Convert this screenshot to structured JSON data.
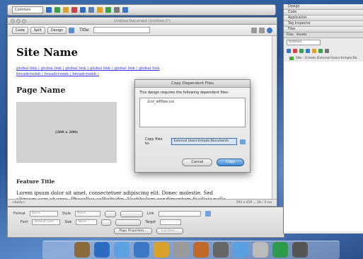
{
  "insert_bar": {
    "category": "Common",
    "icon_colors": [
      "#2d6cc0",
      "#3aa04a",
      "#d9a12a",
      "#c44",
      "#2d6cc0",
      "#5a7fb0",
      "#e0a020",
      "#3aa04a",
      "#7a7a7a",
      "#3a78c4"
    ]
  },
  "document": {
    "window_title": "Untitled Document (Untitled-2*)",
    "view_buttons": [
      "Code",
      "Split",
      "Design"
    ],
    "title_label": "Title:",
    "site_name": "Site Name",
    "nav_links_line1": "global link | global link | global link | global link | global link | global link",
    "nav_links_line2": "breadcrumb | breadcrumb | breadcrumb |",
    "page_name": "Page Name",
    "image_placeholder": "(200 x 200)",
    "feature_title": "Feature Title",
    "lorem": "Lorem ipsum dolor sit amet, consectetuer adipiscing elit. Donec molestie. Sed aliquam sem ut arcu. Phasellus sollicitudin. Vestibulum condimentum facilisis nulla. In hac",
    "status_tag": "<body>",
    "status_size": "593 x 459 ⌄ 28 / 3 sec"
  },
  "dialog": {
    "title": "Copy Dependent Files",
    "message": "This design requires the following dependent files:",
    "file": "2col_leftNav.css",
    "copy_label": "Copy files to:",
    "copy_path": "External Users:trimple:Documents",
    "cancel": "Cancel",
    "copy": "Copy"
  },
  "properties": {
    "format_label": "Format",
    "format_value": "None",
    "style_label": "Style",
    "style_value": "None",
    "link_label": "Link",
    "font_label": "Font",
    "font_value": "Default Font",
    "size_label": "Size",
    "size_value": "None",
    "target_label": "Target",
    "page_props": "Page Properties...",
    "list_item": "List Item..."
  },
  "panels": {
    "headers": [
      "Design",
      "Code",
      "Application",
      "Tag Inspector",
      "Files"
    ],
    "files_tabs": [
      "Files",
      "Assets"
    ],
    "site_combo": "Untitled",
    "site_row": "Site - iCreate (External Users:trimple:Do",
    "tool_colors": [
      "#3a78c4",
      "#d44",
      "#3aa04a",
      "#3a78c4",
      "#e0a020",
      "#3aa04a",
      "#777"
    ]
  },
  "dock": {
    "colors": [
      "#8a6a3a",
      "#2d6cc0",
      "#5da0e0",
      "#3a78c4",
      "#d9a12a",
      "#9a9a9a",
      "#c06a2a",
      "#666",
      "#5aa0e0",
      "#bbb",
      "#2e9a4a",
      "#555"
    ]
  }
}
